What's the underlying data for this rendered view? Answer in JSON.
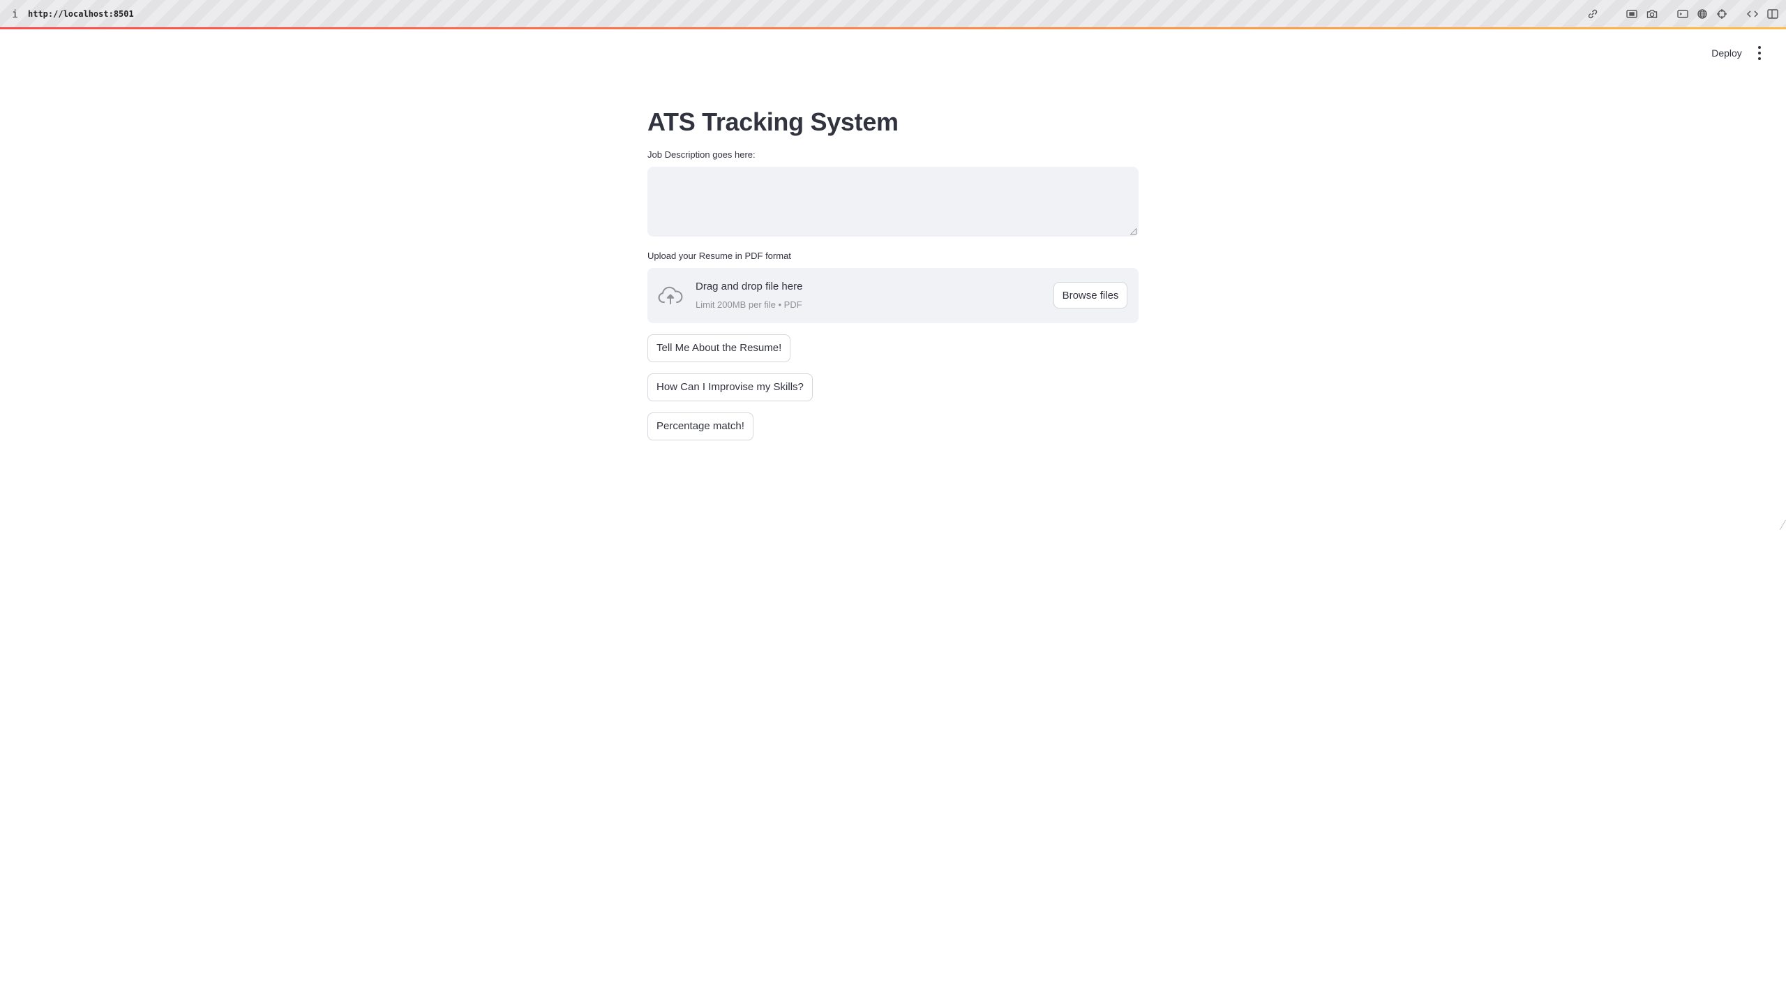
{
  "browser": {
    "info_glyph": "i",
    "url": "http://localhost:8501",
    "toolbar_icons": [
      "link-icon",
      "screenshot-icon",
      "camera-icon",
      "terminal-icon",
      "globe-icon",
      "crosshair-icon",
      "code-icon",
      "split-view-icon"
    ]
  },
  "header": {
    "deploy_label": "Deploy",
    "menu_icon": "kebab-menu-icon"
  },
  "main": {
    "title": "ATS Tracking System",
    "job_description_label": "Job Description goes here:",
    "job_description_value": "",
    "upload_label": "Upload your Resume in PDF format",
    "uploader": {
      "icon": "cloud-upload-icon",
      "drag_text": "Drag and drop file here",
      "limit_text": "Limit 200MB per file • PDF",
      "browse_label": "Browse files"
    },
    "buttons": [
      {
        "label": "Tell Me About the Resume!"
      },
      {
        "label": "How Can I Improvise my Skills?"
      },
      {
        "label": "Percentage match!"
      }
    ]
  },
  "colors": {
    "accent_start": "#ff4b4b",
    "accent_end": "#ffbd45",
    "input_background": "#f0f2f6",
    "text": "#31333f",
    "muted_text": "#8e9199",
    "button_border": "#d5d7de"
  }
}
